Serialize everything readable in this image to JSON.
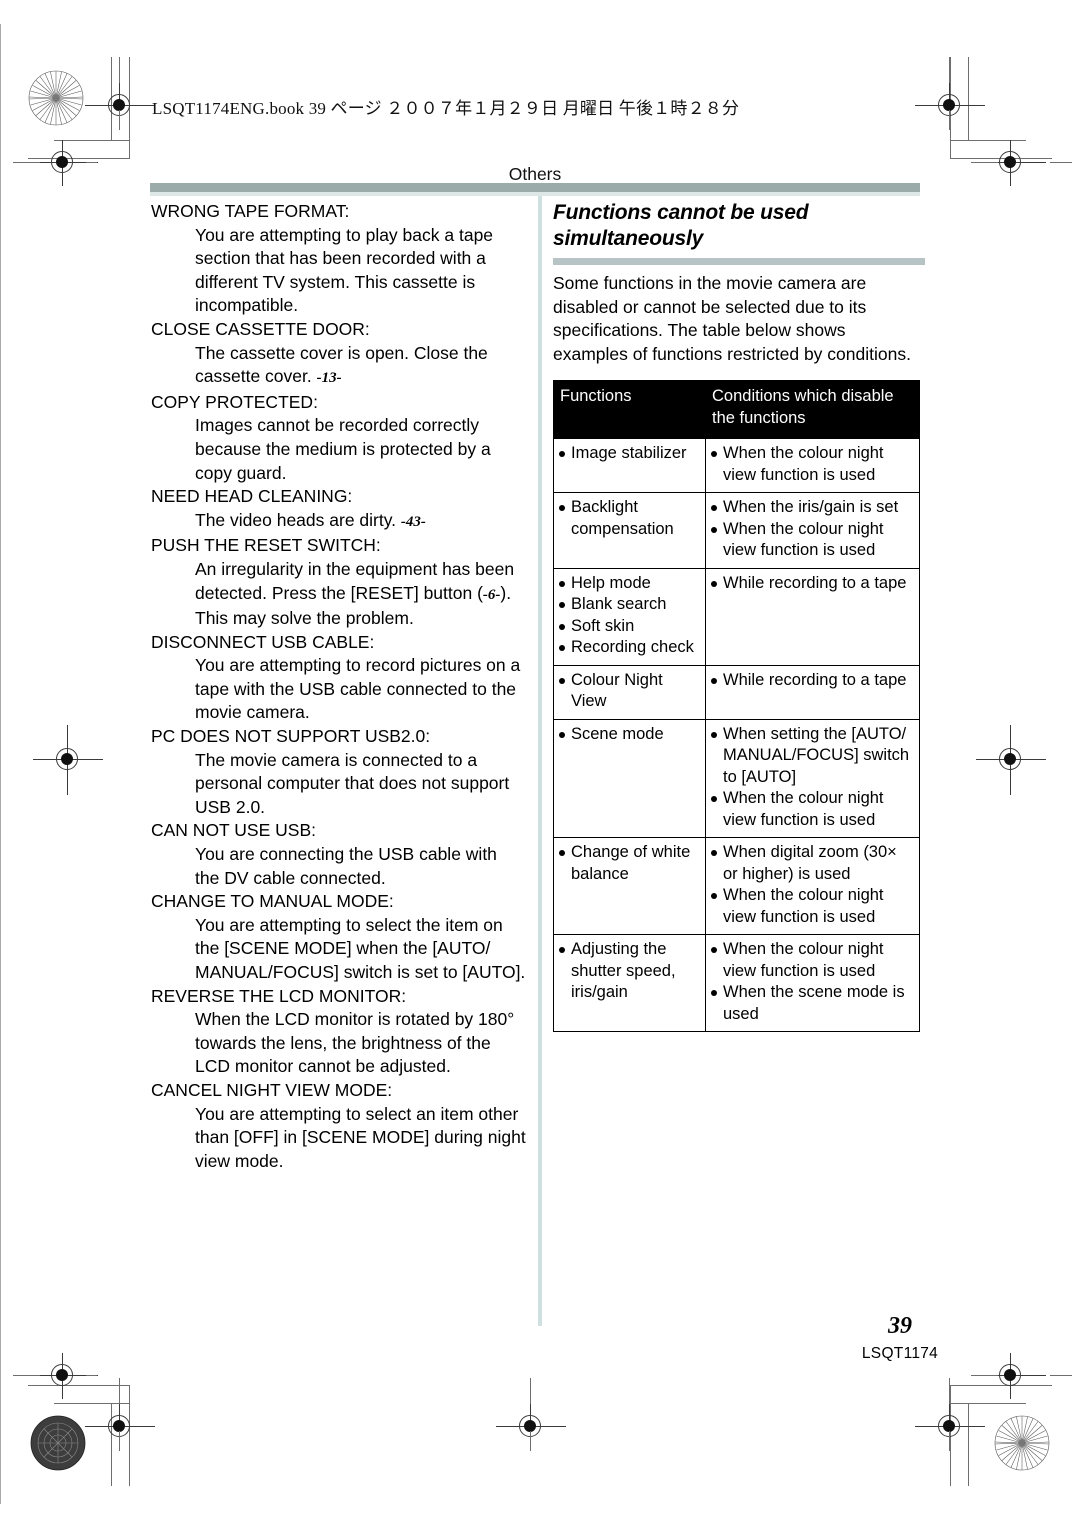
{
  "document": {
    "book_header": "LSQT1174ENG.book   39 ページ   ２００７年１月２９日   月曜日   午後１時２８分",
    "section_label": "Others",
    "page_number": "39",
    "page_code": "LSQT1174",
    "accent_bar_color": "#9aaba9",
    "divider_color": "#cfe0e1",
    "heading_bar_color": "#b6c4c5"
  },
  "left_column": {
    "entries": [
      {
        "term": "WRONG TAPE FORMAT:",
        "description": "You are attempting to play back a tape section that has been recorded with a different TV system. This cassette is incompatible.",
        "ref": ""
      },
      {
        "term": "CLOSE CASSETTE DOOR:",
        "description": "The cassette cover is open. Close the cassette cover.",
        "ref": "-13-"
      },
      {
        "term": "COPY PROTECTED:",
        "description": "Images cannot be recorded correctly because the medium is protected by a copy guard.",
        "ref": ""
      },
      {
        "term": "NEED HEAD CLEANING:",
        "description": "The video heads are dirty.",
        "ref": "-43-"
      },
      {
        "term": "PUSH THE RESET SWITCH:",
        "description_pre": "An irregularity in the equipment has been detected. Press the [RESET] button (",
        "ref": "-6-",
        "description_post": "). This may solve the problem."
      },
      {
        "term": "DISCONNECT USB CABLE:",
        "description": "You are attempting to record pictures on a tape with the USB cable connected to the movie camera.",
        "ref": ""
      },
      {
        "term": "PC DOES NOT SUPPORT USB2.0:",
        "description": "The movie camera is connected to a personal computer that does not support USB 2.0.",
        "ref": ""
      },
      {
        "term": "CAN NOT USE USB:",
        "description": "You are connecting the USB cable with the DV cable connected.",
        "ref": ""
      },
      {
        "term": "CHANGE TO MANUAL MODE:",
        "description": "You are attempting to select the item on the [SCENE MODE] when the [AUTO/ MANUAL/FOCUS] switch is set to [AUTO].",
        "ref": ""
      },
      {
        "term": "REVERSE THE LCD MONITOR:",
        "description": "When the LCD monitor is rotated by 180° towards the lens, the brightness of the LCD monitor cannot be adjusted.",
        "ref": ""
      },
      {
        "term": "CANCEL NIGHT VIEW MODE:",
        "description": "You are attempting to select an item other than [OFF] in [SCENE MODE] during night view mode.",
        "ref": ""
      }
    ]
  },
  "right_column": {
    "heading": "Functions cannot be used simultaneously",
    "intro": "Some functions in the movie camera are disabled or cannot be selected due to its specifications. The table below shows examples of functions restricted by conditions.",
    "table": {
      "headers": [
        "Functions",
        "Conditions which disable the functions"
      ],
      "rows": [
        {
          "functions": [
            "Image stabilizer"
          ],
          "conditions": [
            "When the colour night view function is used"
          ]
        },
        {
          "functions": [
            "Backlight compensation"
          ],
          "conditions": [
            "When the iris/gain is set",
            "When the colour night view function is used"
          ]
        },
        {
          "functions": [
            "Help mode",
            "Blank search",
            "Soft skin",
            "Recording check"
          ],
          "conditions": [
            "While recording to a tape"
          ]
        },
        {
          "functions": [
            "Colour Night View"
          ],
          "conditions": [
            "While recording to a tape"
          ]
        },
        {
          "functions": [
            "Scene mode"
          ],
          "conditions": [
            "When setting the [AUTO/ MANUAL/FOCUS] switch to [AUTO]",
            "When the colour night view function is used"
          ]
        },
        {
          "functions": [
            "Change of white balance"
          ],
          "conditions": [
            "When digital zoom (30× or higher) is used",
            "When the colour night view function is used"
          ]
        },
        {
          "functions": [
            "Adjusting the shutter speed, iris/gain"
          ],
          "conditions": [
            "When the colour night view function is used",
            "When the scene mode is used"
          ]
        }
      ]
    }
  }
}
